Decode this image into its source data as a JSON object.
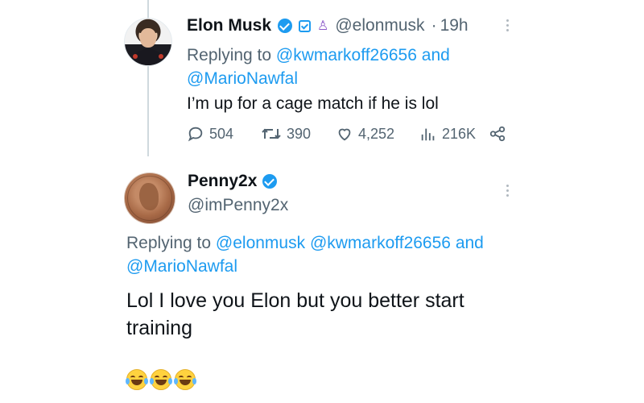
{
  "tweet1": {
    "author_name": "Elon Musk",
    "handle": "@elonmusk",
    "separator": "·",
    "time": "19h",
    "replying_prefix": "Replying to",
    "replying_user1": "@kwmarkoff26656",
    "replying_and": "and",
    "replying_user2": "@MarioNawfal",
    "text": "I’m up for a cage match if he is lol",
    "stats": {
      "replies": "504",
      "retweets": "390",
      "likes": "4,252",
      "views": "216K"
    }
  },
  "tweet2": {
    "author_name": "Penny2x",
    "handle": "@imPenny2x",
    "replying_prefix": "Replying to",
    "replying_user1": "@elonmusk",
    "replying_user2": "@kwmarkoff26656",
    "replying_and": "and",
    "replying_user3": "@MarioNawfal",
    "text_line1": "Lol I love you Elon but you better start",
    "text_line2": "training",
    "emoji_count": 3,
    "emoji_name": "face-with-tears-of-joy"
  },
  "colors": {
    "link": "#1d9bf0",
    "secondary_text": "#536471",
    "primary_text": "#0f1419"
  },
  "icons": [
    "verified-icon",
    "square-badge-icon",
    "government-badge-icon",
    "more-icon",
    "reply-icon",
    "retweet-icon",
    "like-icon",
    "views-icon",
    "share-icon",
    "laughing-emoji-icon"
  ]
}
